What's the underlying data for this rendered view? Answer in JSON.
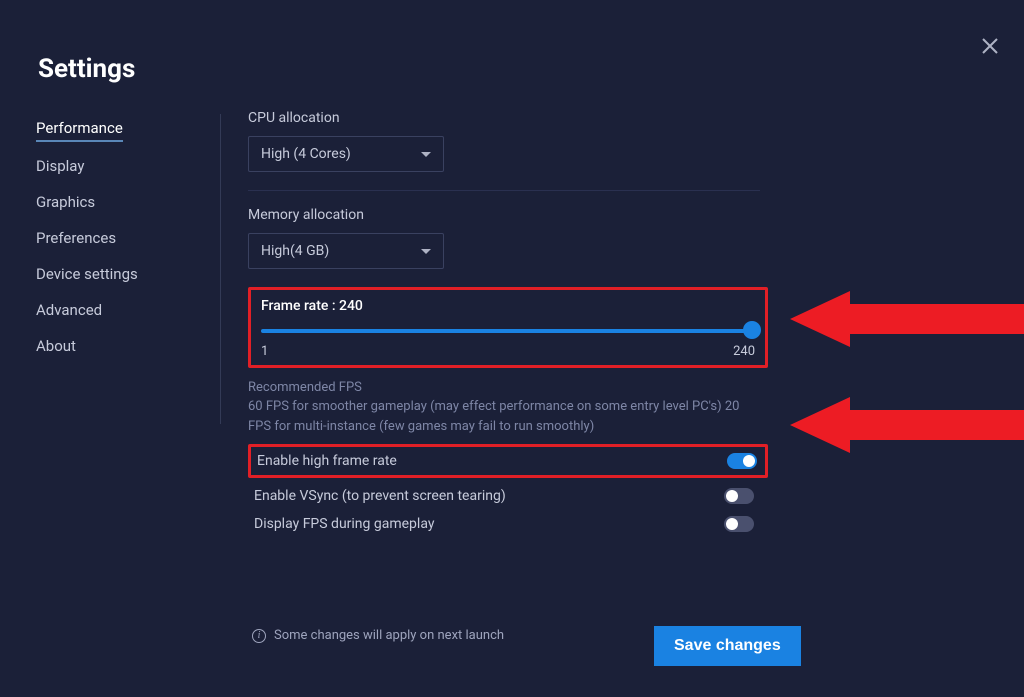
{
  "title": "Settings",
  "sidebar": {
    "items": [
      {
        "label": "Performance",
        "active": true
      },
      {
        "label": "Display"
      },
      {
        "label": "Graphics"
      },
      {
        "label": "Preferences"
      },
      {
        "label": "Device settings"
      },
      {
        "label": "Advanced"
      },
      {
        "label": "About"
      }
    ]
  },
  "cpu": {
    "label": "CPU allocation",
    "value": "High (4 Cores)"
  },
  "memory": {
    "label": "Memory allocation",
    "value": "High(4 GB)"
  },
  "frame": {
    "title": "Frame rate : 240",
    "min": "1",
    "max": "240"
  },
  "recommended": {
    "heading": "Recommended FPS",
    "text": "60 FPS for smoother gameplay (may effect performance on some entry level PC's) 20 FPS for multi-instance (few games may fail to run smoothly)"
  },
  "toggles": {
    "high_fps": {
      "label": "Enable high frame rate",
      "on": true
    },
    "vsync": {
      "label": "Enable VSync (to prevent screen tearing)",
      "on": false
    },
    "show_fps": {
      "label": "Display FPS during gameplay",
      "on": false
    }
  },
  "footer": {
    "note": "Some changes will apply on next launch",
    "save": "Save changes"
  }
}
